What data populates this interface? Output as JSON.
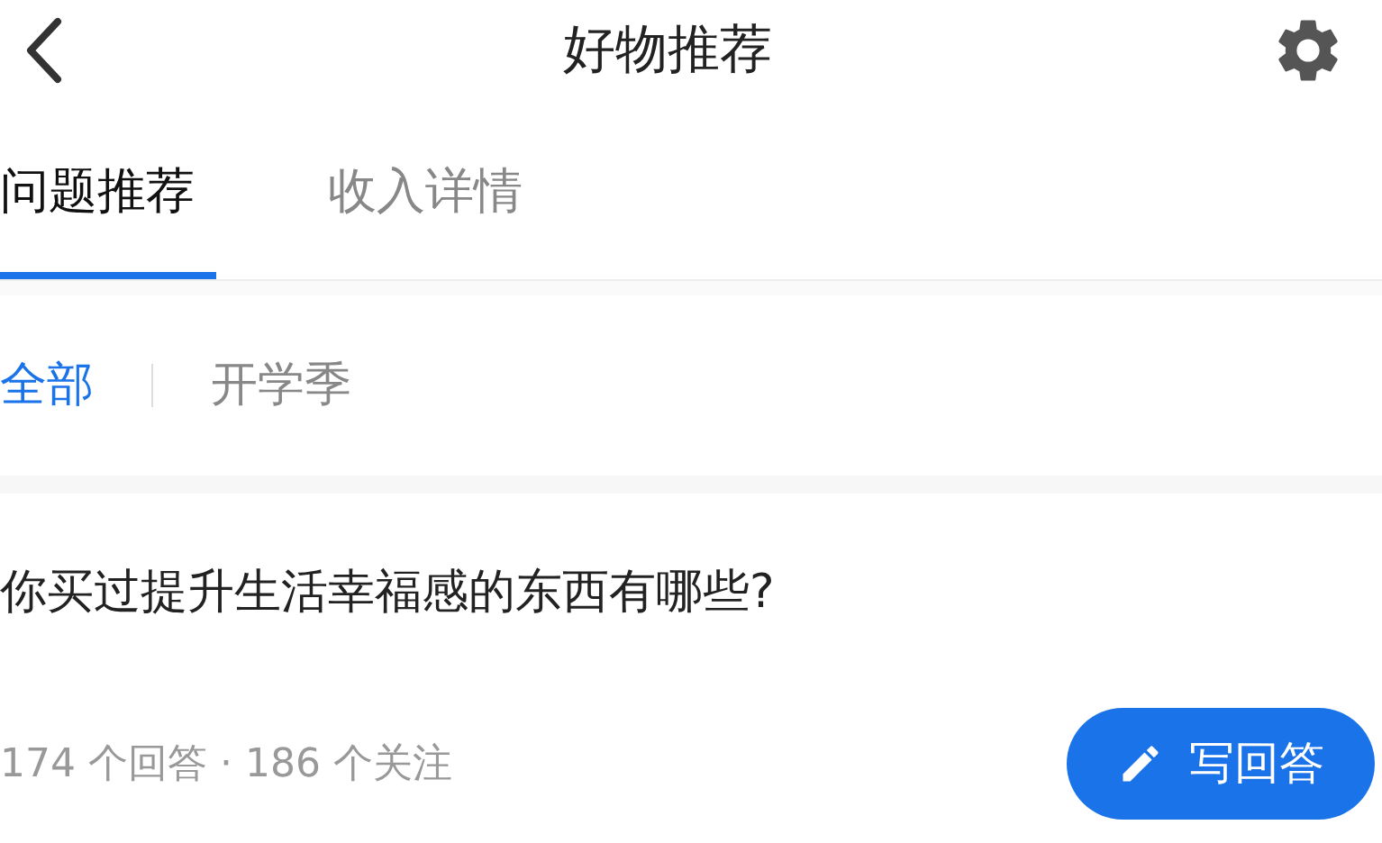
{
  "header": {
    "title": "好物推荐"
  },
  "tabs": [
    {
      "label": "问题推荐",
      "selected": true
    },
    {
      "label": "收入详情",
      "selected": false
    }
  ],
  "filters": [
    {
      "label": "全部",
      "selected": true
    },
    {
      "label": "开学季",
      "selected": false
    }
  ],
  "question": {
    "title": "你买过提升生活幸福感的东西有哪些?",
    "stats": "174 个回答 · 186 个关注",
    "button": "写回答"
  }
}
